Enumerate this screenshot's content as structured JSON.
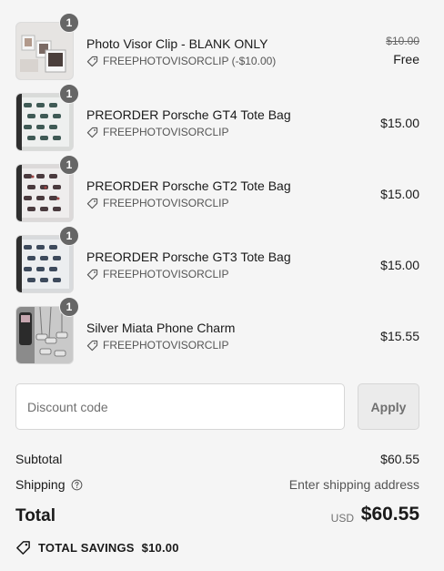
{
  "items": [
    {
      "name": "Photo Visor Clip - BLANK ONLY",
      "qty": "1",
      "discount_code": "FREEPHOTOVISORCLIP (-$10.00)",
      "original_price": "$10.00",
      "price": "Free"
    },
    {
      "name": "PREORDER Porsche GT4 Tote Bag",
      "qty": "1",
      "discount_code": "FREEPHOTOVISORCLIP",
      "price": "$15.00"
    },
    {
      "name": "PREORDER Porsche GT2 Tote Bag",
      "qty": "1",
      "discount_code": "FREEPHOTOVISORCLIP",
      "price": "$15.00"
    },
    {
      "name": "PREORDER Porsche GT3 Tote Bag",
      "qty": "1",
      "discount_code": "FREEPHOTOVISORCLIP",
      "price": "$15.00"
    },
    {
      "name": "Silver Miata Phone Charm",
      "qty": "1",
      "discount_code": "FREEPHOTOVISORCLIP",
      "price": "$15.55"
    }
  ],
  "discount": {
    "placeholder": "Discount code",
    "apply_label": "Apply"
  },
  "summary": {
    "subtotal_label": "Subtotal",
    "subtotal_value": "$60.55",
    "shipping_label": "Shipping",
    "shipping_value": "Enter shipping address",
    "total_label": "Total",
    "currency": "USD",
    "total_value": "$60.55",
    "savings_label": "TOTAL SAVINGS",
    "savings_value": "$10.00"
  },
  "icons": {
    "tag": "tag-icon",
    "help": "help-circle-icon",
    "savings": "savings-tag-icon"
  },
  "colors": {
    "background": "#f5f5f5",
    "badge": "#666666",
    "apply_button_bg": "#ebebeb",
    "muted_text": "#707070"
  }
}
